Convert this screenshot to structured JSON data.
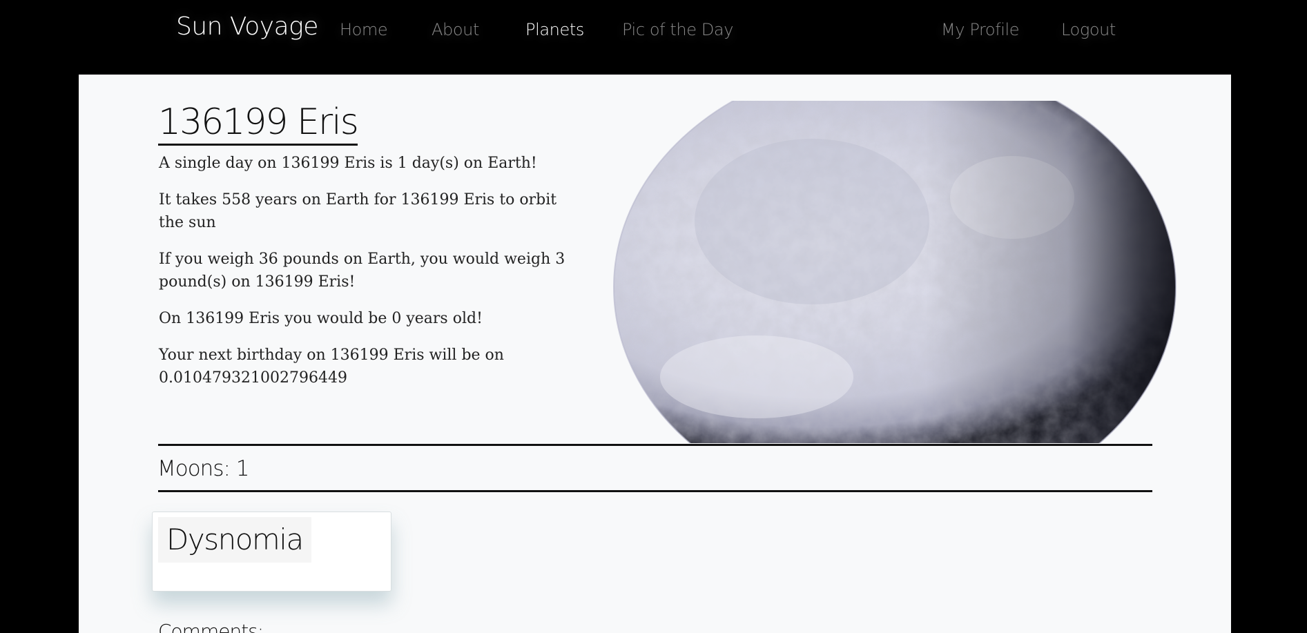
{
  "nav": {
    "brand": "Sun Voyage",
    "links": [
      {
        "label": "Home",
        "active": false
      },
      {
        "label": "About",
        "active": false
      },
      {
        "label": "Planets",
        "active": true
      },
      {
        "label": "Pic of the Day",
        "active": false
      }
    ],
    "right_links": [
      {
        "label": "My Profile"
      },
      {
        "label": "Logout"
      }
    ]
  },
  "planet": {
    "name": "136199 Eris",
    "facts": [
      "A single day on 136199 Eris is 1 day(s) on Earth!",
      "It takes 558 years on Earth for 136199 Eris to orbit the sun",
      "If you weigh 36 pounds on Earth, you would weigh 3 pound(s) on 136199 Eris!",
      "On 136199 Eris you would be 0 years old!",
      "Your next birthday on 136199 Eris will be on 0.010479321002796449"
    ],
    "image_icon": "planet-image"
  },
  "moons": {
    "heading": "Moons: 1",
    "items": [
      {
        "name": "Dysnomia"
      }
    ]
  },
  "comments": {
    "heading": "Comments:"
  },
  "colors": {
    "nav_bg": "#000000",
    "panel_bg": "#f8f9fa",
    "nav_inactive": "#8a8a8a",
    "nav_active": "#ffffff",
    "text": "#111111"
  }
}
